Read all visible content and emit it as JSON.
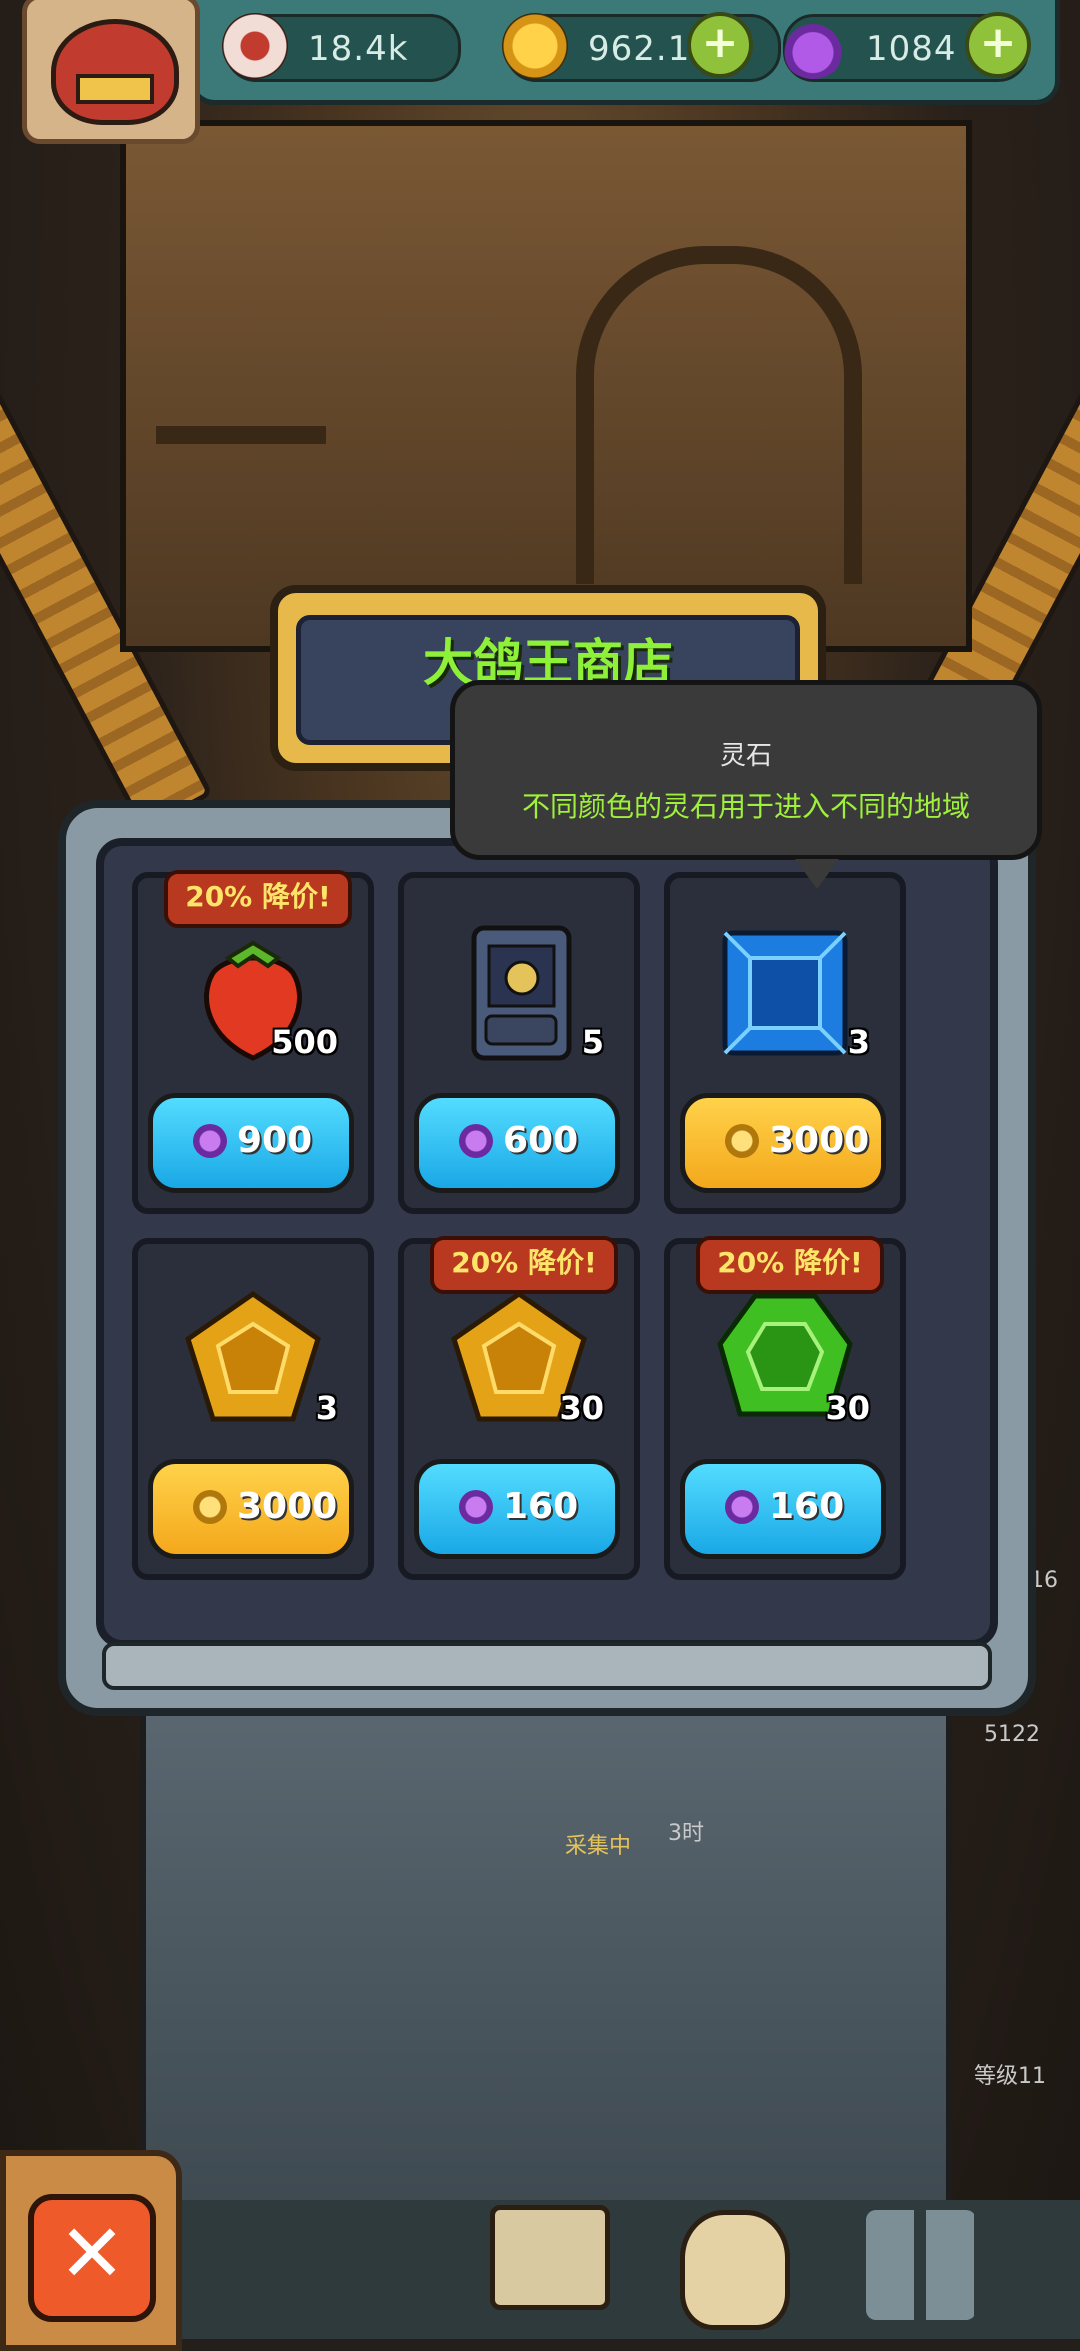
{
  "hud": {
    "eyes": "18.4k",
    "coins": "962.1k",
    "potions": "1084"
  },
  "shop": {
    "title": "大鸽王商店",
    "items": [
      {
        "name": "strawberry",
        "count": "500",
        "price": "900",
        "currency": "potion",
        "discount": "20% 降价!"
      },
      {
        "name": "card",
        "count": "5",
        "price": "600",
        "currency": "potion",
        "discount": ""
      },
      {
        "name": "blue-gem",
        "count": "3",
        "price": "3000",
        "currency": "coin",
        "discount": ""
      },
      {
        "name": "gold-gem",
        "count": "3",
        "price": "3000",
        "currency": "coin",
        "discount": ""
      },
      {
        "name": "gold-gem",
        "count": "30",
        "price": "160",
        "currency": "potion",
        "discount": "20% 降价!"
      },
      {
        "name": "green-gem",
        "count": "30",
        "price": "160",
        "currency": "potion",
        "discount": "20% 降价!"
      }
    ]
  },
  "tooltip": {
    "title": "灵石",
    "description": "不同颜色的灵石用于进入不同的地域"
  },
  "background": {
    "collecting": "采集中",
    "time": "3时",
    "num_16": "16",
    "num_5122": "5122",
    "level": "等级11"
  },
  "colors": {
    "accent_green": "#8ff03a",
    "discount_red": "#b8391f",
    "potion_blue": "#1aa8e6",
    "coin_gold": "#f4a81c"
  }
}
